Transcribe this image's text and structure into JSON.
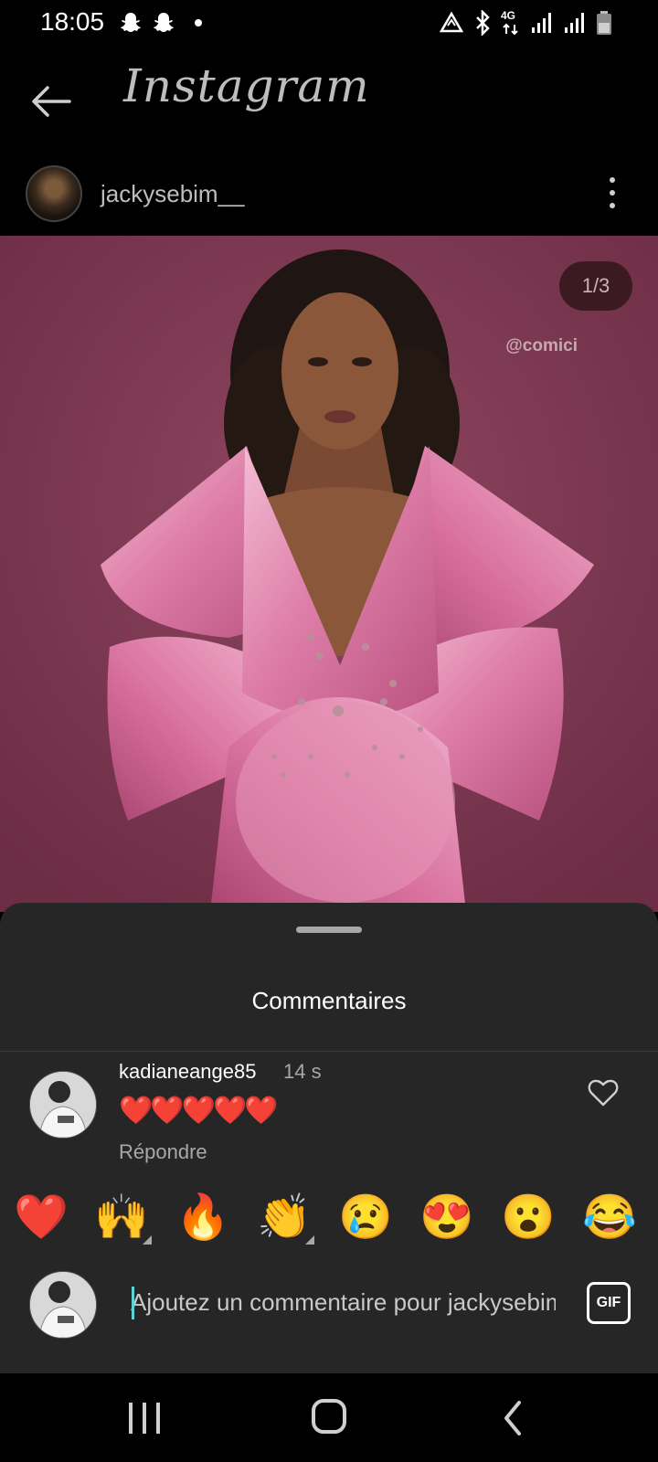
{
  "status_bar": {
    "time": "18:05",
    "network_label": "4G",
    "icons": [
      "snapchat-icon",
      "snapchat-icon",
      "notification-dot",
      "data-saver-icon",
      "bluetooth-icon",
      "network-4g-icon",
      "signal-icon",
      "signal-icon",
      "battery-icon"
    ]
  },
  "app_bar": {
    "title": "Instagram",
    "back_icon": "arrow-left-icon"
  },
  "post": {
    "username": "jackysebim__",
    "image_counter": "1/3",
    "watermark": "@comici",
    "more_icon": "more-vertical-icon"
  },
  "comments_sheet": {
    "title": "Commentaires",
    "comments": [
      {
        "username": "kadianeange85",
        "time": "14 s",
        "text": "❤️❤️❤️❤️❤️",
        "reply_label": "Répondre"
      }
    ],
    "quick_reactions": [
      "❤️",
      "🙌",
      "🔥",
      "👏",
      "😢",
      "😍",
      "😮",
      "😂"
    ],
    "composer": {
      "placeholder": "Ajoutez un commentaire pour jackysebim__...",
      "gif_label": "GIF"
    }
  },
  "nav_bar": {
    "buttons": [
      "recents-icon",
      "home-icon",
      "back-icon"
    ]
  },
  "colors": {
    "background": "#000000",
    "sheet": "#262626",
    "photo_backdrop": "#7d3951",
    "muted_text": "#a8a8a8",
    "caret": "#5fd3d3"
  }
}
